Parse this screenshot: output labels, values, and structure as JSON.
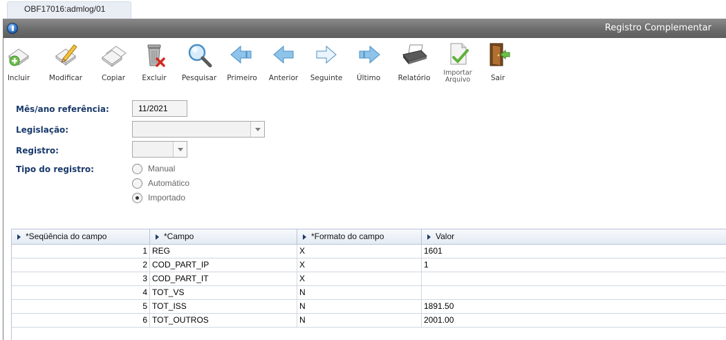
{
  "tab": {
    "label": "OBF17016:admlog/01"
  },
  "window": {
    "title": "Registro Complementar"
  },
  "toolbar": {
    "incluir": "Incluir",
    "modificar": "Modificar",
    "copiar": "Copiar",
    "excluir": "Excluir",
    "pesquisar": "Pesquisar",
    "primeiro": "Primeiro",
    "anterior": "Anterior",
    "seguinte": "Seguinte",
    "ultimo": "Último",
    "relatorio": "Relatório",
    "importar_line1": "Importar",
    "importar_line2": "Arquivo",
    "sair": "Sair"
  },
  "form": {
    "mes_ano_label": "Mês/ano referência:",
    "mes_ano_value": "11/2021",
    "legislacao_label": "Legislação:",
    "legislacao_value": "",
    "registro_label": "Registro:",
    "registro_value": "",
    "tipo_label": "Tipo do registro:",
    "tipo_options": [
      "Manual",
      "Automático",
      "Importado"
    ],
    "tipo_selected": "Importado"
  },
  "grid": {
    "headers": [
      "*Seqüência do campo",
      "*Campo",
      "*Formato do campo",
      "Valor"
    ],
    "rows": [
      {
        "seq": "1",
        "campo": "REG",
        "formato": "X",
        "valor": "1601"
      },
      {
        "seq": "2",
        "campo": "COD_PART_IP",
        "formato": "X",
        "valor": "1"
      },
      {
        "seq": "3",
        "campo": "COD_PART_IT",
        "formato": "X",
        "valor": ""
      },
      {
        "seq": "4",
        "campo": "TOT_VS",
        "formato": "N",
        "valor": ""
      },
      {
        "seq": "5",
        "campo": "TOT_ISS",
        "formato": "N",
        "valor": "1891.50"
      },
      {
        "seq": "6",
        "campo": "TOT_OUTROS",
        "formato": "N",
        "valor": "2001.00"
      }
    ]
  }
}
